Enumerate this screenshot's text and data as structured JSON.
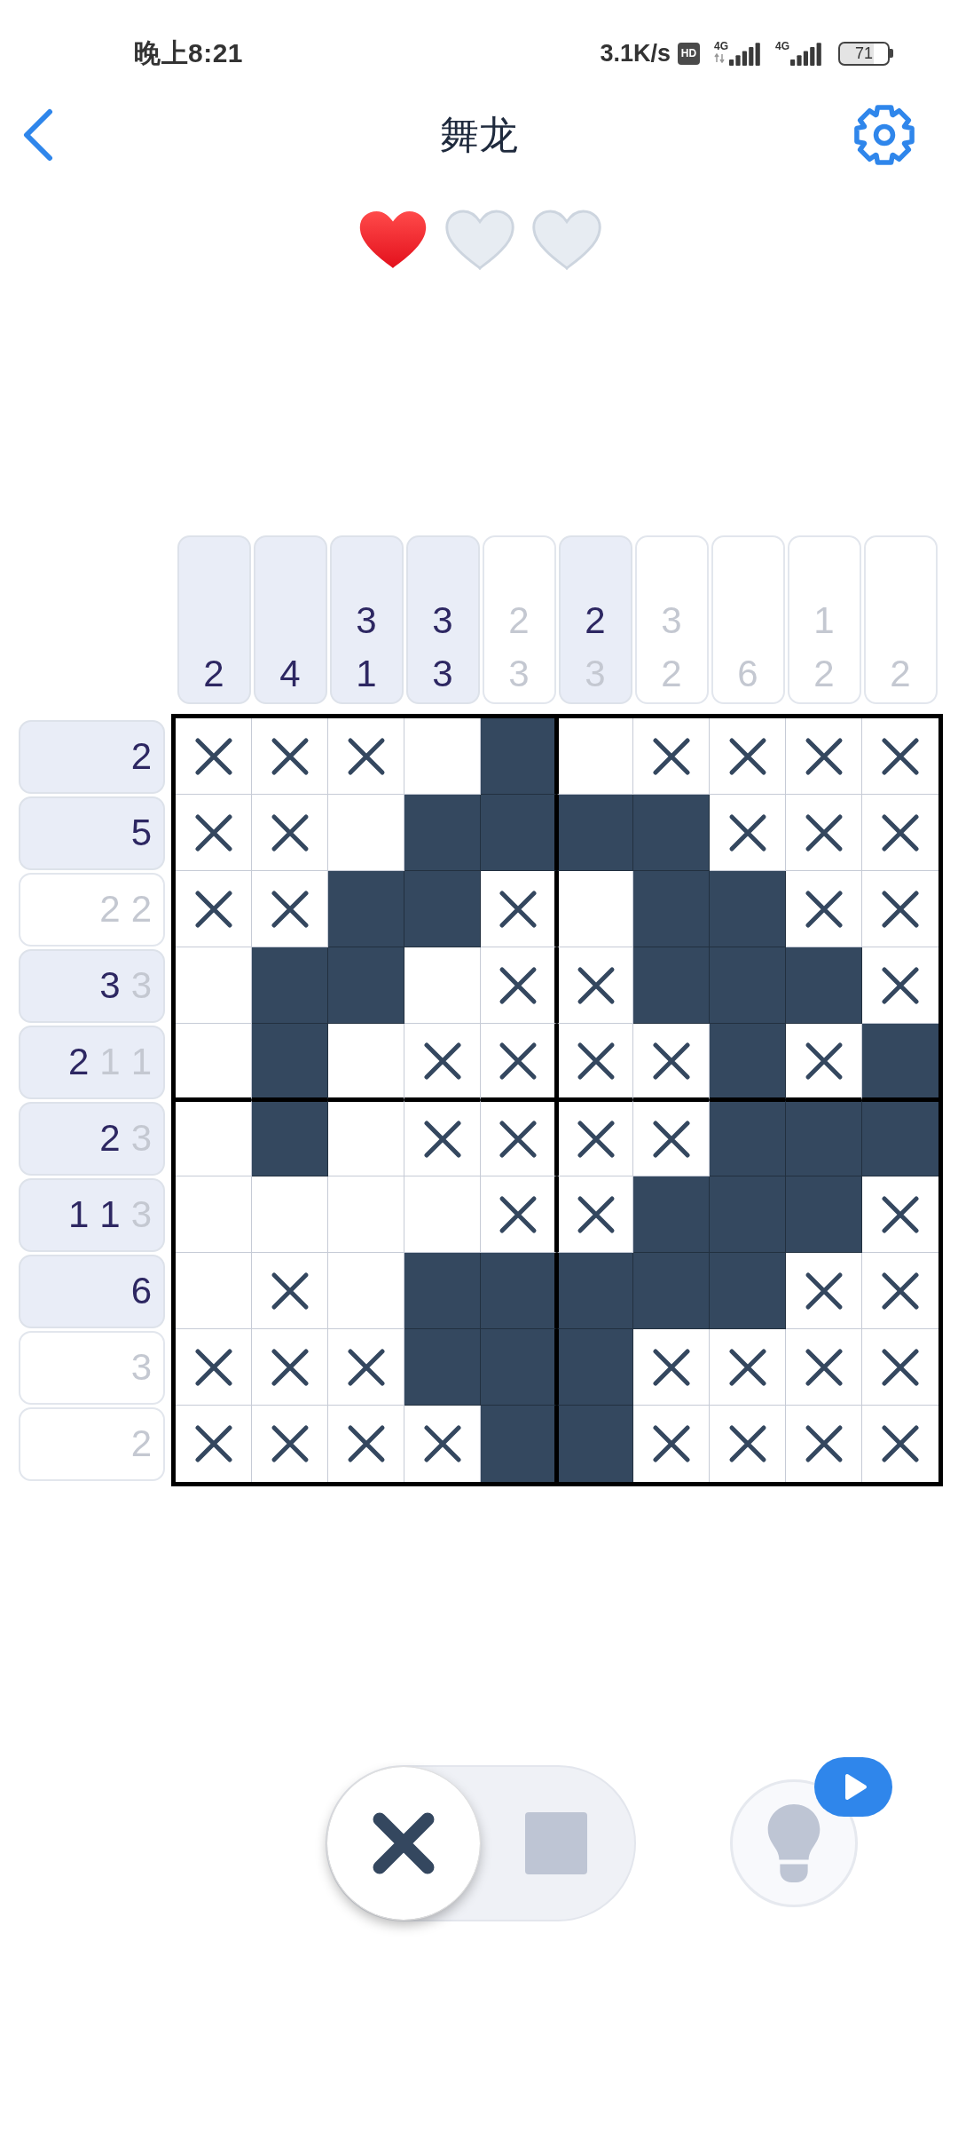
{
  "status_bar": {
    "time": "晚上8:21",
    "network_speed": "3.1K/s",
    "hd_badge": "HD",
    "networks": [
      {
        "label": "4G",
        "data_activity": true
      },
      {
        "label": "4G",
        "data_activity": false
      }
    ],
    "battery": "71"
  },
  "header": {
    "title": "舞龙"
  },
  "lives": [
    {
      "filled": true
    },
    {
      "filled": false
    },
    {
      "filled": false
    }
  ],
  "puzzle": {
    "column_clues": [
      {
        "solved": false,
        "numbers": [
          {
            "value": "2",
            "done": false
          }
        ]
      },
      {
        "solved": false,
        "numbers": [
          {
            "value": "4",
            "done": false
          }
        ]
      },
      {
        "solved": false,
        "numbers": [
          {
            "value": "3",
            "done": false
          },
          {
            "value": "1",
            "done": false
          }
        ]
      },
      {
        "solved": false,
        "numbers": [
          {
            "value": "3",
            "done": false
          },
          {
            "value": "3",
            "done": false
          }
        ]
      },
      {
        "solved": true,
        "numbers": [
          {
            "value": "2",
            "done": true
          },
          {
            "value": "3",
            "done": true
          }
        ]
      },
      {
        "solved": false,
        "numbers": [
          {
            "value": "2",
            "done": false
          },
          {
            "value": "3",
            "done": true
          }
        ]
      },
      {
        "solved": true,
        "numbers": [
          {
            "value": "3",
            "done": true
          },
          {
            "value": "2",
            "done": true
          }
        ]
      },
      {
        "solved": true,
        "numbers": [
          {
            "value": "6",
            "done": true
          }
        ]
      },
      {
        "solved": true,
        "numbers": [
          {
            "value": "1",
            "done": true
          },
          {
            "value": "2",
            "done": true
          }
        ]
      },
      {
        "solved": true,
        "numbers": [
          {
            "value": "2",
            "done": true
          }
        ]
      }
    ],
    "row_clues": [
      {
        "solved": false,
        "numbers": [
          {
            "value": "2",
            "done": false
          }
        ]
      },
      {
        "solved": false,
        "numbers": [
          {
            "value": "5",
            "done": false
          }
        ]
      },
      {
        "solved": true,
        "numbers": [
          {
            "value": "2",
            "done": true
          },
          {
            "value": "2",
            "done": true
          }
        ]
      },
      {
        "solved": false,
        "numbers": [
          {
            "value": "3",
            "done": false
          },
          {
            "value": "3",
            "done": true
          }
        ]
      },
      {
        "solved": false,
        "numbers": [
          {
            "value": "2",
            "done": false
          },
          {
            "value": "1",
            "done": true
          },
          {
            "value": "1",
            "done": true
          }
        ]
      },
      {
        "solved": false,
        "numbers": [
          {
            "value": "2",
            "done": false
          },
          {
            "value": "3",
            "done": true
          }
        ]
      },
      {
        "solved": false,
        "numbers": [
          {
            "value": "1",
            "done": false
          },
          {
            "value": "1",
            "done": false
          },
          {
            "value": "3",
            "done": true
          }
        ]
      },
      {
        "solved": false,
        "numbers": [
          {
            "value": "6",
            "done": false
          }
        ]
      },
      {
        "solved": true,
        "numbers": [
          {
            "value": "3",
            "done": true
          }
        ]
      },
      {
        "solved": true,
        "numbers": [
          {
            "value": "2",
            "done": true
          }
        ]
      }
    ],
    "grid": [
      {
        "cells": [
          {
            "kind": "cross"
          },
          {
            "kind": "cross"
          },
          {
            "kind": "cross"
          },
          {
            "kind": "empty"
          },
          {
            "kind": "filled"
          },
          {
            "kind": "empty"
          },
          {
            "kind": "cross"
          },
          {
            "kind": "cross"
          },
          {
            "kind": "cross"
          },
          {
            "kind": "cross"
          }
        ]
      },
      {
        "cells": [
          {
            "kind": "cross"
          },
          {
            "kind": "cross"
          },
          {
            "kind": "empty"
          },
          {
            "kind": "filled"
          },
          {
            "kind": "filled"
          },
          {
            "kind": "filled"
          },
          {
            "kind": "filled"
          },
          {
            "kind": "cross"
          },
          {
            "kind": "cross"
          },
          {
            "kind": "cross"
          }
        ]
      },
      {
        "cells": [
          {
            "kind": "cross"
          },
          {
            "kind": "cross"
          },
          {
            "kind": "filled"
          },
          {
            "kind": "filled"
          },
          {
            "kind": "cross"
          },
          {
            "kind": "empty"
          },
          {
            "kind": "filled"
          },
          {
            "kind": "filled"
          },
          {
            "kind": "cross"
          },
          {
            "kind": "cross"
          }
        ]
      },
      {
        "cells": [
          {
            "kind": "empty"
          },
          {
            "kind": "filled"
          },
          {
            "kind": "filled"
          },
          {
            "kind": "empty"
          },
          {
            "kind": "cross"
          },
          {
            "kind": "cross"
          },
          {
            "kind": "filled"
          },
          {
            "kind": "filled"
          },
          {
            "kind": "filled"
          },
          {
            "kind": "cross"
          }
        ]
      },
      {
        "cells": [
          {
            "kind": "empty"
          },
          {
            "kind": "filled"
          },
          {
            "kind": "empty"
          },
          {
            "kind": "cross"
          },
          {
            "kind": "cross"
          },
          {
            "kind": "cross"
          },
          {
            "kind": "cross"
          },
          {
            "kind": "filled"
          },
          {
            "kind": "cross"
          },
          {
            "kind": "filled"
          }
        ]
      },
      {
        "cells": [
          {
            "kind": "empty"
          },
          {
            "kind": "filled"
          },
          {
            "kind": "empty"
          },
          {
            "kind": "cross"
          },
          {
            "kind": "cross"
          },
          {
            "kind": "cross"
          },
          {
            "kind": "cross"
          },
          {
            "kind": "filled"
          },
          {
            "kind": "filled"
          },
          {
            "kind": "filled"
          }
        ]
      },
      {
        "cells": [
          {
            "kind": "empty"
          },
          {
            "kind": "empty"
          },
          {
            "kind": "empty"
          },
          {
            "kind": "empty"
          },
          {
            "kind": "cross"
          },
          {
            "kind": "cross"
          },
          {
            "kind": "filled"
          },
          {
            "kind": "filled"
          },
          {
            "kind": "filled"
          },
          {
            "kind": "cross"
          }
        ]
      },
      {
        "cells": [
          {
            "kind": "empty"
          },
          {
            "kind": "cross"
          },
          {
            "kind": "empty"
          },
          {
            "kind": "filled"
          },
          {
            "kind": "filled"
          },
          {
            "kind": "filled"
          },
          {
            "kind": "filled"
          },
          {
            "kind": "filled"
          },
          {
            "kind": "cross"
          },
          {
            "kind": "cross"
          }
        ]
      },
      {
        "cells": [
          {
            "kind": "cross"
          },
          {
            "kind": "cross"
          },
          {
            "kind": "cross"
          },
          {
            "kind": "filled"
          },
          {
            "kind": "filled"
          },
          {
            "kind": "filled"
          },
          {
            "kind": "cross"
          },
          {
            "kind": "cross"
          },
          {
            "kind": "cross"
          },
          {
            "kind": "cross"
          }
        ]
      },
      {
        "cells": [
          {
            "kind": "cross"
          },
          {
            "kind": "cross"
          },
          {
            "kind": "cross"
          },
          {
            "kind": "cross"
          },
          {
            "kind": "filled"
          },
          {
            "kind": "filled"
          },
          {
            "kind": "cross"
          },
          {
            "kind": "cross"
          },
          {
            "kind": "cross"
          },
          {
            "kind": "cross"
          }
        ]
      }
    ]
  },
  "mode_toggle": [
    {
      "kind": "cross",
      "selected": true
    },
    {
      "kind": "fill",
      "selected": false
    }
  ]
}
